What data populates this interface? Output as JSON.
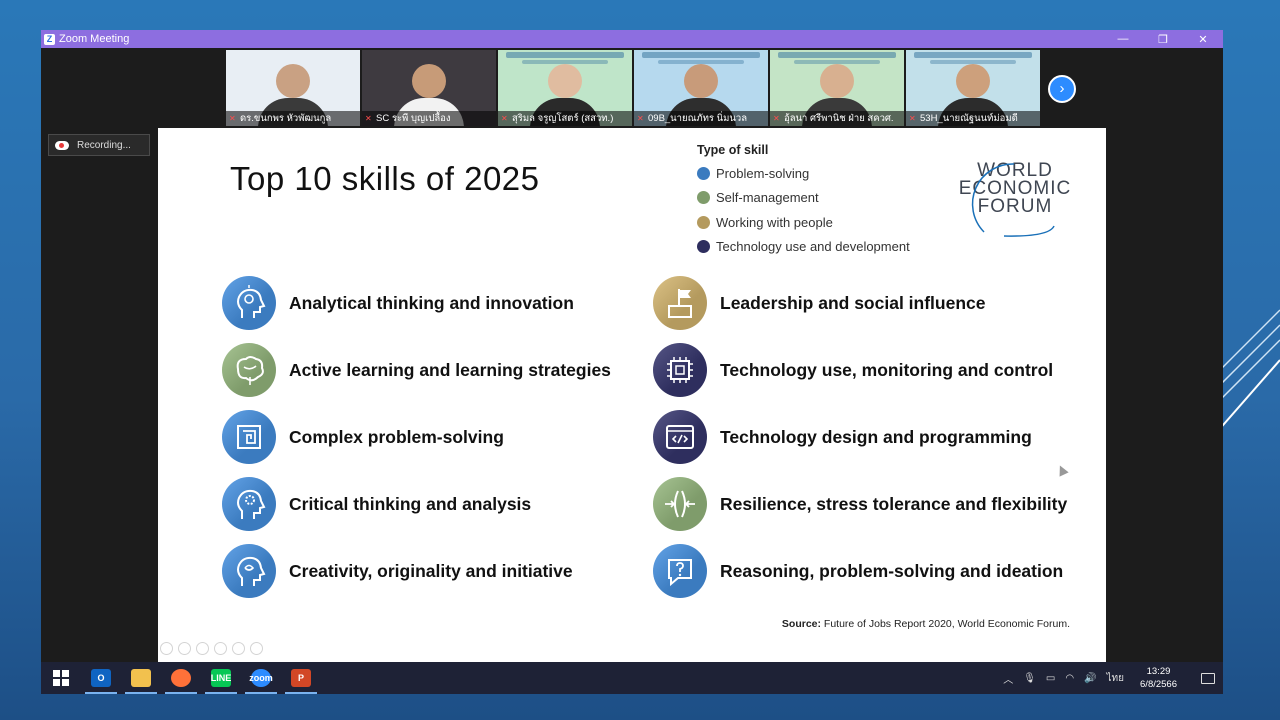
{
  "window": {
    "title": "Zoom Meeting",
    "minimize": "—",
    "restore": "❐",
    "close": "✕"
  },
  "participants": [
    {
      "name": "ดร.ขนกพร หัวพัฒนกูล",
      "bg": "#e8eef4",
      "skin": "#c9a183",
      "shirt": "#3a3a3a"
    },
    {
      "name": "SC ระพี บุญเปลื้อง",
      "bg": "#3e3a40",
      "skin": "#c79b78",
      "shirt": "#f2f2f2"
    },
    {
      "name": "สุริมล จรูญโสตร์ (สสวท.)",
      "bg": "#bfe5c9",
      "skin": "#e0bca0",
      "shirt": "#2a2a2a"
    },
    {
      "name": "09B_นายณภัทร นิ่มนวล",
      "bg": "#b6d9ee",
      "skin": "#c89b7a",
      "shirt": "#2e2e2e"
    },
    {
      "name": "อุ้ลนา ศรีพานิช ฝ่าย สควศ.",
      "bg": "#c4e4c6",
      "skin": "#d8b090",
      "shirt": "#3a3a3a"
    },
    {
      "name": "53H_นายณัฐนนท์ม่อมดี",
      "bg": "#c2e0ea",
      "skin": "#cda07c",
      "shirt": "#2c2c2c"
    }
  ],
  "next_arrow": "›",
  "recording": {
    "label": "Recording..."
  },
  "slide": {
    "title": "Top 10 skills of 2025",
    "legend_title": "Type of skill",
    "legend": [
      {
        "label": "Problem-solving",
        "color": "#3b7bbf"
      },
      {
        "label": "Self-management",
        "color": "#7f9c6b"
      },
      {
        "label": "Working with people",
        "color": "#b49a5e"
      },
      {
        "label": "Technology use and development",
        "color": "#2e2e5e"
      }
    ],
    "logo": [
      "WORLD",
      "ECONOMIC",
      "FORUM"
    ],
    "skills_left": [
      {
        "label": "Analytical thinking and innovation",
        "icon": "lightbulb-head-icon",
        "color": "#3b7bbf"
      },
      {
        "label": "Active learning and learning strategies",
        "icon": "brain-icon",
        "color": "#7f9c6b"
      },
      {
        "label": "Complex problem-solving",
        "icon": "maze-icon",
        "color": "#3b7bbf"
      },
      {
        "label": "Critical thinking and analysis",
        "icon": "gear-head-icon",
        "color": "#3b7bbf"
      },
      {
        "label": "Creativity, originality and initiative",
        "icon": "idea-head-icon",
        "color": "#3b7bbf"
      }
    ],
    "skills_right": [
      {
        "label": "Leadership and social influence",
        "icon": "flag-podium-icon",
        "color": "#b49a5e"
      },
      {
        "label": "Technology use, monitoring and control",
        "icon": "chip-icon",
        "color": "#2e2e5e"
      },
      {
        "label": "Technology design and programming",
        "icon": "code-window-icon",
        "color": "#2e2e5e"
      },
      {
        "label": "Resilience, stress tolerance and flexibility",
        "icon": "compress-arrows-icon",
        "color": "#7f9c6b"
      },
      {
        "label": "Reasoning, problem-solving and ideation",
        "icon": "question-bubble-icon",
        "color": "#3b7bbf"
      }
    ],
    "source_label": "Source:",
    "source_text": " Future of Jobs Report 2020, World Economic Forum."
  },
  "taskbar": {
    "apps": [
      {
        "id": "outlook",
        "label": "O",
        "color": "#0f64c2"
      },
      {
        "id": "explorer",
        "label": "",
        "color": "#f2c14e"
      },
      {
        "id": "firefox",
        "label": "",
        "color": "#ff7139"
      },
      {
        "id": "line",
        "label": "LINE",
        "color": "#06c755"
      },
      {
        "id": "zoom",
        "label": "zoom",
        "color": "#2d8cff"
      },
      {
        "id": "powerpoint",
        "label": "P",
        "color": "#d24726"
      }
    ],
    "language": "ไทย",
    "time": "13:29",
    "date": "6/8/2566"
  }
}
